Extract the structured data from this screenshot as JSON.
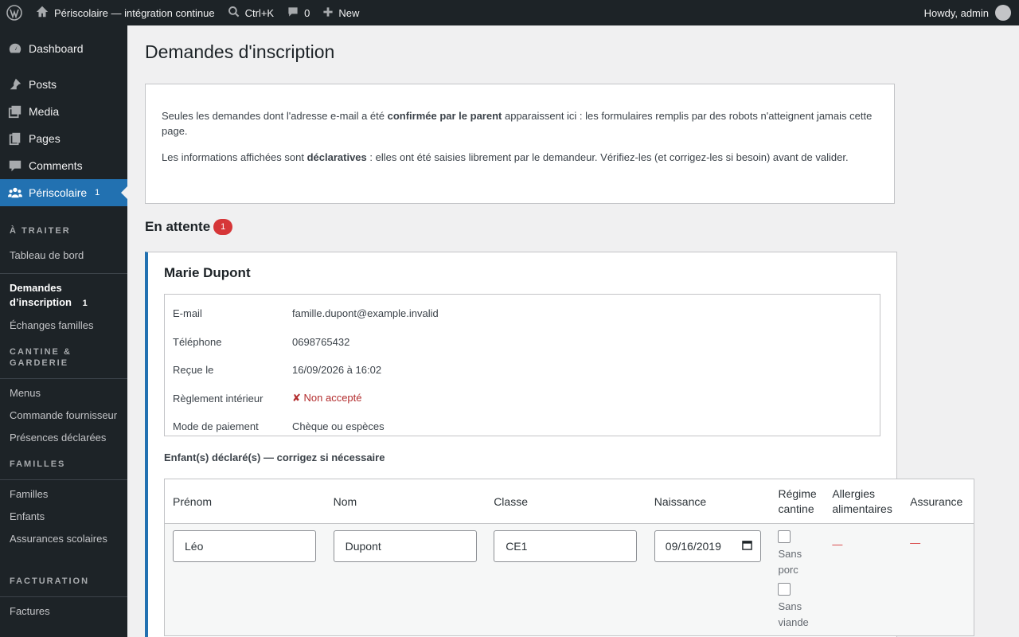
{
  "adminbar": {
    "site_name": "Périscolaire — intégration continue",
    "search_shortcut": "Ctrl+K",
    "comments_count": "0",
    "new_label": "New",
    "howdy": "Howdy, admin"
  },
  "sidebar": {
    "top_items": [
      {
        "label": "Dashboard",
        "icon": "dashboard-icon"
      },
      {
        "label": "Posts",
        "icon": "pin-icon"
      },
      {
        "label": "Media",
        "icon": "media-icon"
      },
      {
        "label": "Pages",
        "icon": "pages-icon"
      },
      {
        "label": "Comments",
        "icon": "comment-icon"
      },
      {
        "label": "Périscolaire",
        "icon": "groups-icon",
        "badge": "1"
      }
    ],
    "sections": {
      "a_traiter": "À TRAITER",
      "tableau_de_bord": "Tableau de bord",
      "demandes": "Demandes d’inscription",
      "demandes_badge": "1",
      "echanges": "Échanges familles",
      "cantine": "CANTINE & GARDERIE",
      "menus": "Menus",
      "commande": "Commande fournisseur",
      "presences": "Présences déclarées",
      "familles_h": "FAMILLES",
      "familles": "Familles",
      "enfants": "Enfants",
      "assurances": "Assurances scolaires",
      "facturation": "FACTURATION",
      "factures": "Factures"
    }
  },
  "page": {
    "title": "Demandes d'inscription",
    "notice": {
      "p1_a": "Seules les demandes dont l'adresse e-mail a été ",
      "p1_b": "confirmée par le parent",
      "p1_c": " apparaissent ici : les formulaires remplis par des robots n'atteignent jamais cette page.",
      "p2_a": "Les informations affichées sont ",
      "p2_b": "déclaratives",
      "p2_c": " : elles ont été saisies librement par le demandeur. Vérifiez-les (et corrigez-les si besoin) avant de valider."
    },
    "pending_title": "En attente",
    "pending_count": "1",
    "request": {
      "name": "Marie Dupont",
      "fields": [
        {
          "key": "E-mail",
          "value": "famille.dupont@example.invalid"
        },
        {
          "key": "Téléphone",
          "value": "0698765432"
        },
        {
          "key": "Reçue le",
          "value": "16/09/2026 à 16:02"
        },
        {
          "key": "Règlement intérieur",
          "value": "✘ Non accepté"
        },
        {
          "key": "Mode de paiement",
          "value": "Chèque ou espèces"
        }
      ],
      "children_heading": "Enfant(s) déclaré(s) — corrigez si nécessaire",
      "columns": [
        "Prénom",
        "Nom",
        "Classe",
        "Naissance",
        "Régime cantine",
        "Allergies alimentaires",
        "Assurance"
      ],
      "child": {
        "prenom": "Léo",
        "nom": "Dupont",
        "classe": "CE1",
        "naissance": "09/16/2019",
        "regime_options": [
          "Sans porc",
          "Sans viande"
        ],
        "allergies": "—",
        "assurance": "—"
      }
    }
  }
}
